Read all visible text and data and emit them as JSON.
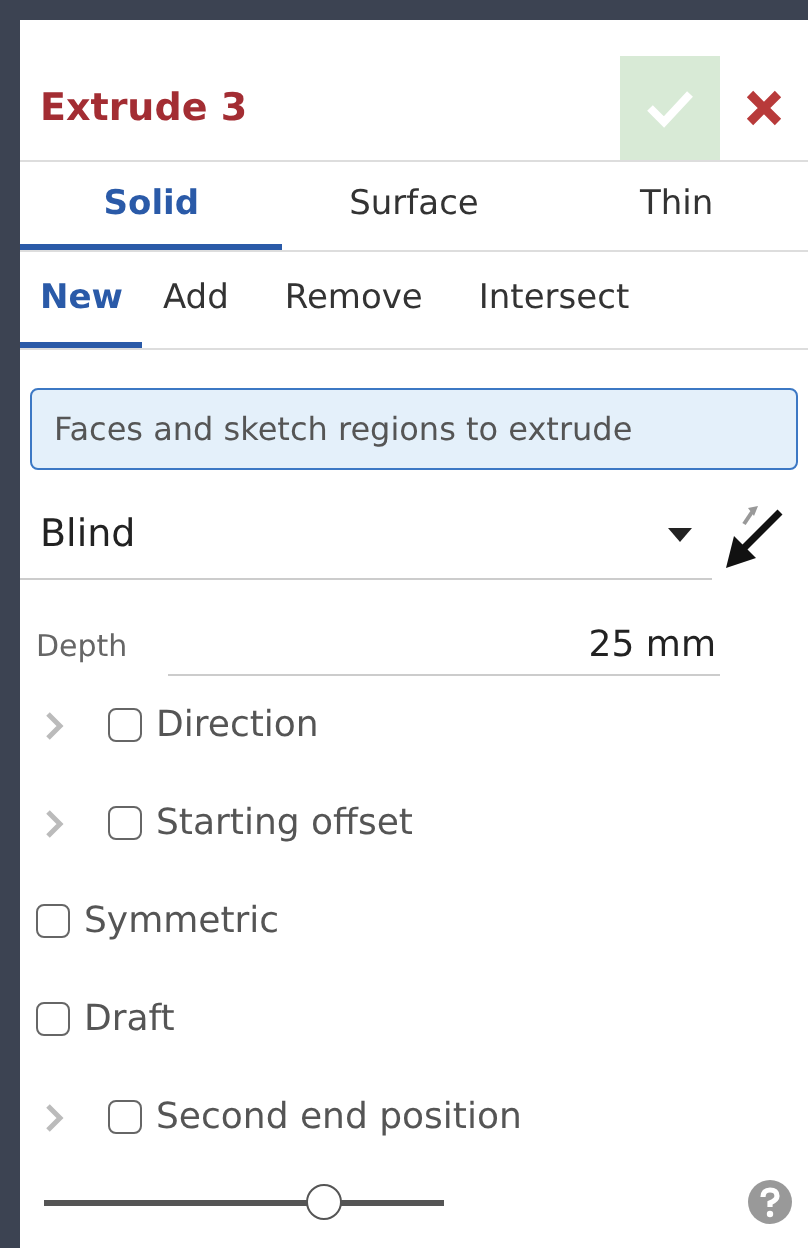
{
  "title": "Extrude 3",
  "tabs": [
    {
      "label": "Solid",
      "selected": true
    },
    {
      "label": "Surface",
      "selected": false
    },
    {
      "label": "Thin",
      "selected": false
    }
  ],
  "operations": [
    {
      "label": "New",
      "selected": true
    },
    {
      "label": "Add",
      "selected": false
    },
    {
      "label": "Remove",
      "selected": false
    },
    {
      "label": "Intersect",
      "selected": false
    }
  ],
  "selection": {
    "placeholder": "Faces and sketch regions to extrude"
  },
  "end_type": "Blind",
  "depth": {
    "label": "Depth",
    "value": "25 mm"
  },
  "options": [
    {
      "label": "Direction",
      "expandable": true,
      "checked": false
    },
    {
      "label": "Starting offset",
      "expandable": true,
      "checked": false
    },
    {
      "label": "Symmetric",
      "expandable": false,
      "checked": false
    },
    {
      "label": "Draft",
      "expandable": false,
      "checked": false
    },
    {
      "label": "Second end position",
      "expandable": true,
      "checked": false
    }
  ],
  "slider": {
    "level": 0.7
  }
}
